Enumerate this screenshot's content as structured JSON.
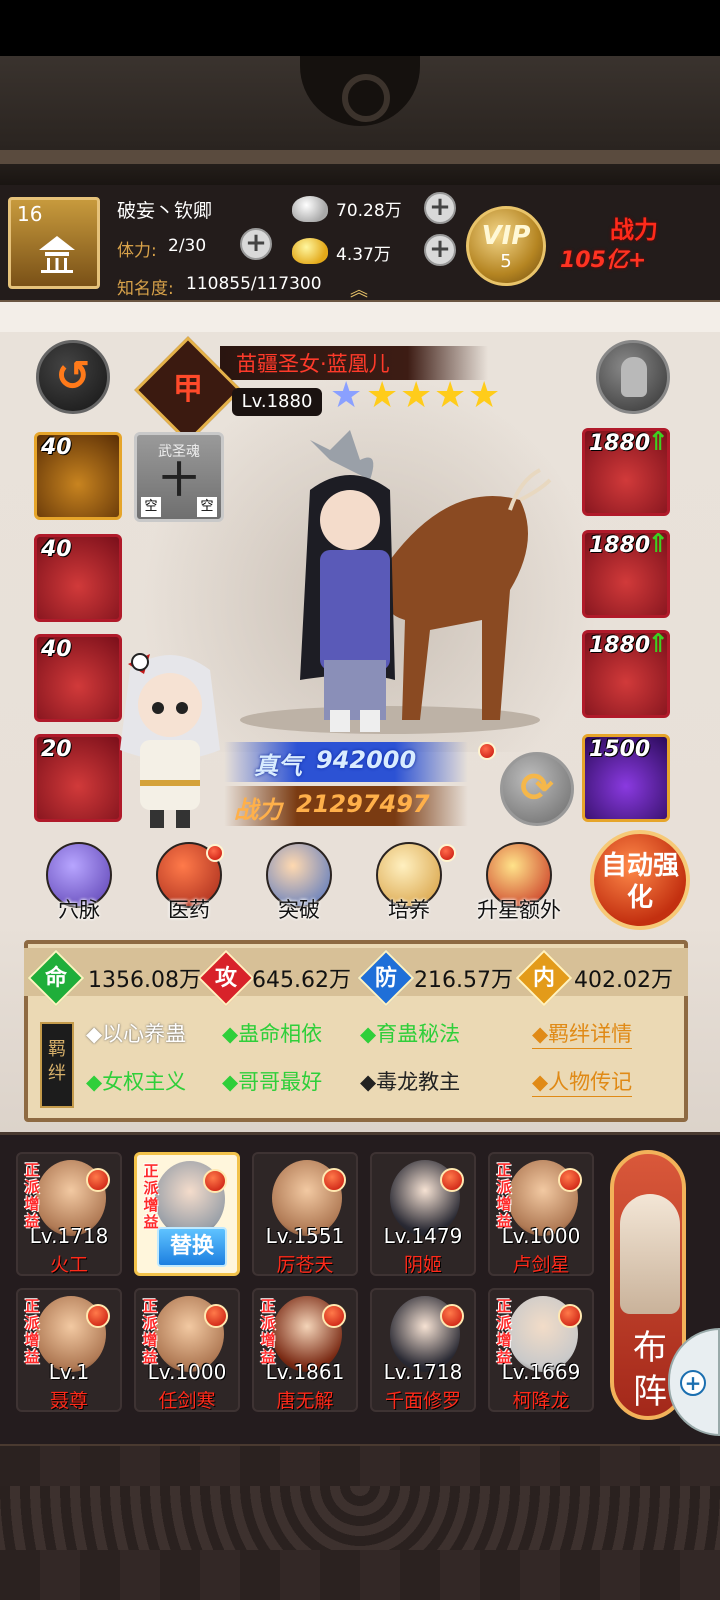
{
  "player": {
    "level": "16",
    "name": "破妄丶钦卿",
    "stamina_label": "体力:",
    "stamina_value": "2/30",
    "fame_label": "知名度:",
    "fame_value": "110855/117300",
    "silver": "70.28万",
    "gold": "4.37万",
    "vip_label": "VIP",
    "vip_level": "5",
    "power_label": "战力",
    "power_value": "105亿+"
  },
  "hero": {
    "name": "苗疆圣女·蓝凰儿",
    "type_char": "甲",
    "level": "Lv.1880",
    "stars_total": 5,
    "stars_gold": 4,
    "qi_label": "真气",
    "qi_value": "942000",
    "power_label": "战力",
    "power_value": "21297497"
  },
  "soul_slot": {
    "title": "武圣魂",
    "char": "十",
    "empty_left": "空",
    "empty_right": "空"
  },
  "equip_left": [
    {
      "level": "40",
      "rarity": "gold"
    },
    {
      "level": "40",
      "rarity": "red"
    },
    {
      "level": "40",
      "rarity": "red"
    },
    {
      "level": "20",
      "rarity": "red"
    }
  ],
  "equip_right": [
    {
      "level": "1880",
      "rarity": "red",
      "upgrade": true
    },
    {
      "level": "1880",
      "rarity": "red",
      "upgrade": true
    },
    {
      "level": "1880",
      "rarity": "red",
      "upgrade": true
    },
    {
      "level": "1500",
      "rarity": "purple",
      "upgrade": false
    }
  ],
  "functions": [
    {
      "label": "穴脉",
      "icon": "meridian-icon"
    },
    {
      "label": "医药",
      "icon": "medicine-icon"
    },
    {
      "label": "突破",
      "icon": "breakthrough-icon"
    },
    {
      "label": "培养",
      "icon": "cultivate-icon"
    },
    {
      "label": "升星额外",
      "icon": "star-up-icon"
    }
  ],
  "auto_strengthen": "自动强化",
  "stats": [
    {
      "key": "命",
      "value": "1356.08万",
      "color": "#1fae3a"
    },
    {
      "key": "攻",
      "value": "645.62万",
      "color": "#d8222a"
    },
    {
      "key": "防",
      "value": "216.57万",
      "color": "#1f6fd8"
    },
    {
      "key": "内",
      "value": "402.02万",
      "color": "#e39b1a"
    }
  ],
  "bond_tag": "羁绊",
  "bonds_row1": [
    {
      "text": "◆以心养蛊",
      "active": false
    },
    {
      "text": "◆蛊命相依",
      "active": true
    },
    {
      "text": "◆育蛊秘法",
      "active": true
    }
  ],
  "bonds_row2": [
    {
      "text": "◆女权主义",
      "active": true
    },
    {
      "text": "◆哥哥最好",
      "active": true
    },
    {
      "text": "◆毒龙教主",
      "active": false
    }
  ],
  "links": {
    "bond_detail": "◆羁绊详情",
    "biography": "◆人物传记"
  },
  "team_row1": [
    {
      "tag": "正派增益",
      "level": "Lv.1718",
      "name": "火工"
    },
    {
      "tag": "正派增益",
      "level": "",
      "name": "",
      "selected": true,
      "button": "替换"
    },
    {
      "tag": "",
      "level": "Lv.1551",
      "name": "厉苍天"
    },
    {
      "tag": "",
      "level": "Lv.1479",
      "name": "阴姬"
    },
    {
      "tag": "正派增益",
      "level": "Lv.1000",
      "name": "卢剑星"
    }
  ],
  "team_row2": [
    {
      "tag": "正派增益",
      "level": "Lv.1",
      "name": "聂尊"
    },
    {
      "tag": "正派增益",
      "level": "Lv.1000",
      "name": "任剑寒"
    },
    {
      "tag": "正派增益",
      "level": "Lv.1861",
      "name": "唐无解"
    },
    {
      "tag": "",
      "level": "Lv.1718",
      "name": "千面修罗"
    },
    {
      "tag": "正派增益",
      "level": "Lv.1669",
      "name": "柯降龙"
    }
  ],
  "formation_label": "布阵"
}
